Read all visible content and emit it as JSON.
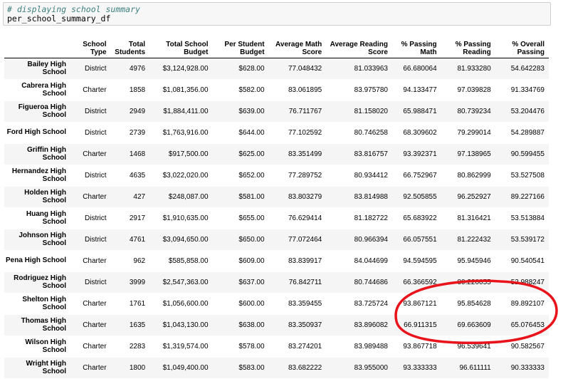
{
  "code_cell": {
    "comment": "# displaying school summary",
    "code": "per_school_summary_df"
  },
  "table": {
    "columns": [
      "School Type",
      "Total Students",
      "Total School Budget",
      "Per Student Budget",
      "Average Math Score",
      "Average Reading Score",
      "% Passing Math",
      "% Passing Reading",
      "% Overall Passing"
    ],
    "column_lines": [
      [
        "School",
        "Type"
      ],
      [
        "Total",
        "Students"
      ],
      [
        "Total School",
        "Budget"
      ],
      [
        "Per Student",
        "Budget"
      ],
      [
        "Average Math",
        "Score"
      ],
      [
        "Average Reading",
        "Score"
      ],
      [
        "% Passing",
        "Math"
      ],
      [
        "% Passing",
        "Reading"
      ],
      [
        "% Overall",
        "Passing"
      ]
    ],
    "rows": [
      {
        "name": [
          "Bailey High",
          "School"
        ],
        "cells": [
          "District",
          "4976",
          "$3,124,928.00",
          "$628.00",
          "77.048432",
          "81.033963",
          "66.680064",
          "81.933280",
          "54.642283"
        ]
      },
      {
        "name": [
          "Cabrera High",
          "School"
        ],
        "cells": [
          "Charter",
          "1858",
          "$1,081,356.00",
          "$582.00",
          "83.061895",
          "83.975780",
          "94.133477",
          "97.039828",
          "91.334769"
        ]
      },
      {
        "name": [
          "Figueroa High",
          "School"
        ],
        "cells": [
          "District",
          "2949",
          "$1,884,411.00",
          "$639.00",
          "76.711767",
          "81.158020",
          "65.988471",
          "80.739234",
          "53.204476"
        ]
      },
      {
        "name": [
          "Ford High School"
        ],
        "cells": [
          "District",
          "2739",
          "$1,763,916.00",
          "$644.00",
          "77.102592",
          "80.746258",
          "68.309602",
          "79.299014",
          "54.289887"
        ]
      },
      {
        "name": [
          "Griffin High",
          "School"
        ],
        "cells": [
          "Charter",
          "1468",
          "$917,500.00",
          "$625.00",
          "83.351499",
          "83.816757",
          "93.392371",
          "97.138965",
          "90.599455"
        ]
      },
      {
        "name": [
          "Hernandez High",
          "School"
        ],
        "cells": [
          "District",
          "4635",
          "$3,022,020.00",
          "$652.00",
          "77.289752",
          "80.934412",
          "66.752967",
          "80.862999",
          "53.527508"
        ]
      },
      {
        "name": [
          "Holden High",
          "School"
        ],
        "cells": [
          "Charter",
          "427",
          "$248,087.00",
          "$581.00",
          "83.803279",
          "83.814988",
          "92.505855",
          "96.252927",
          "89.227166"
        ]
      },
      {
        "name": [
          "Huang High",
          "School"
        ],
        "cells": [
          "District",
          "2917",
          "$1,910,635.00",
          "$655.00",
          "76.629414",
          "81.182722",
          "65.683922",
          "81.316421",
          "53.513884"
        ]
      },
      {
        "name": [
          "Johnson High",
          "School"
        ],
        "cells": [
          "District",
          "4761",
          "$3,094,650.00",
          "$650.00",
          "77.072464",
          "80.966394",
          "66.057551",
          "81.222432",
          "53.539172"
        ]
      },
      {
        "name": [
          "Pena High School"
        ],
        "cells": [
          "Charter",
          "962",
          "$585,858.00",
          "$609.00",
          "83.839917",
          "84.044699",
          "94.594595",
          "95.945946",
          "90.540541"
        ]
      },
      {
        "name": [
          "Rodriguez High",
          "School"
        ],
        "cells": [
          "District",
          "3999",
          "$2,547,363.00",
          "$637.00",
          "76.842711",
          "80.744686",
          "66.366592",
          "80.220055",
          "52.988247"
        ]
      },
      {
        "name": [
          "Shelton High",
          "School"
        ],
        "cells": [
          "Charter",
          "1761",
          "$1,056,600.00",
          "$600.00",
          "83.359455",
          "83.725724",
          "93.867121",
          "95.854628",
          "89.892107"
        ]
      },
      {
        "name": [
          "Thomas High",
          "School"
        ],
        "cells": [
          "Charter",
          "1635",
          "$1,043,130.00",
          "$638.00",
          "83.350937",
          "83.896082",
          "66.911315",
          "69.663609",
          "65.076453"
        ]
      },
      {
        "name": [
          "Wilson High",
          "School"
        ],
        "cells": [
          "Charter",
          "2283",
          "$1,319,574.00",
          "$578.00",
          "83.274201",
          "83.989488",
          "93.867718",
          "96.539641",
          "90.582567"
        ]
      },
      {
        "name": [
          "Wright High",
          "School"
        ],
        "cells": [
          "Charter",
          "1800",
          "$1,049,400.00",
          "$583.00",
          "83.682222",
          "83.955000",
          "93.333333",
          "96.611111",
          "90.333333"
        ]
      }
    ]
  },
  "annotation": {
    "color": "#e8131b",
    "shape": "ellipse",
    "highlighted_row": "Thomas High School"
  }
}
